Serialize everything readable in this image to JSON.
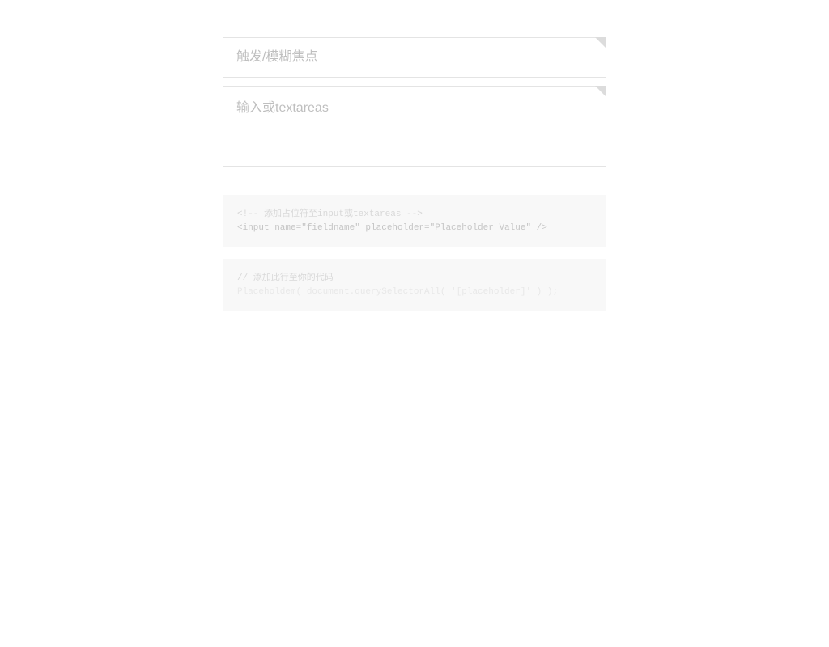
{
  "inputs": {
    "focus_placeholder": "触发/模糊焦点",
    "textarea_placeholder": "输入或textareas"
  },
  "code_block_1": {
    "comment": "<!-- 添加占位符至input或textareas -->",
    "line1": "<input name=\"fieldname\" placeholder=\"Placeholder Value\" />"
  },
  "code_block_2": {
    "comment": "// 添加此行至你的代码",
    "line1": "Placeholdem( document.querySelectorAll( '[placeholder]' ) );"
  }
}
